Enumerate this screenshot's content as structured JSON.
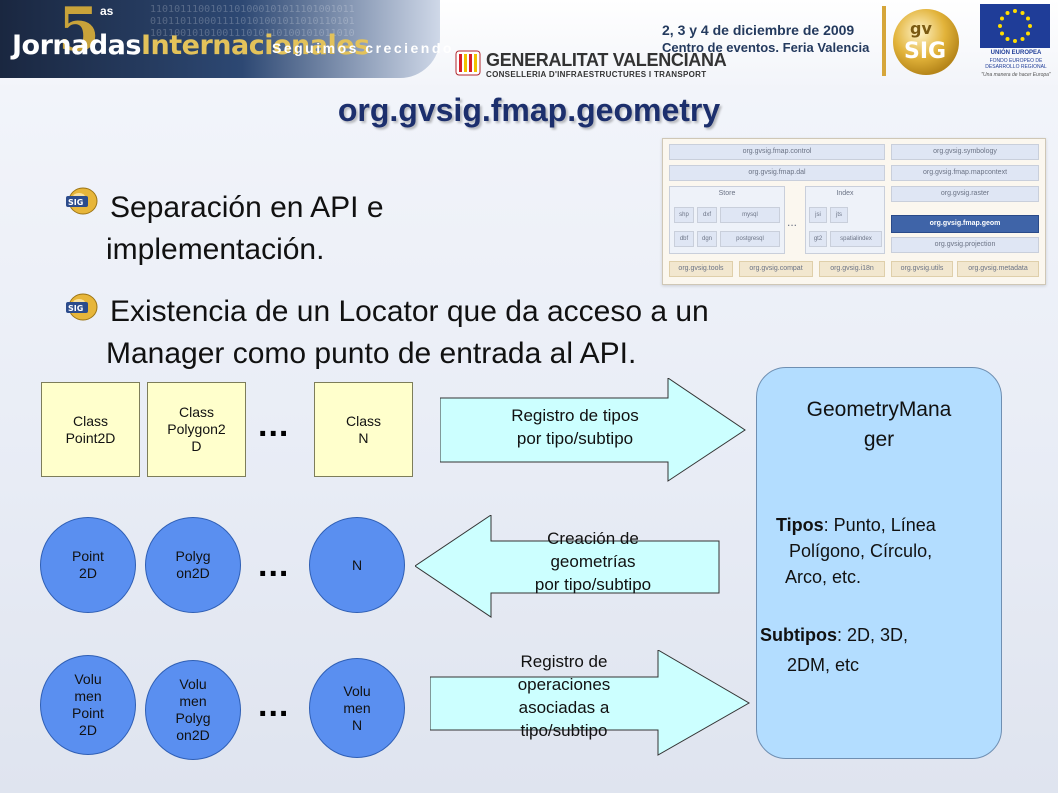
{
  "header": {
    "logo_number": "5",
    "logo_superscript": "as",
    "logo_title_a": "Jornadas",
    "logo_title_b": "Internacionales",
    "logo_slogan": "Seguimos creciendo",
    "event_date": "2, 3 y 4 de diciembre de 2009",
    "event_place": "Centro de eventos. Feria Valencia",
    "sponsor_name": "GENERALITAT VALENCIANA",
    "sponsor_dept": "CONSELLERIA D'INFRAESTRUCTURES I TRANSPORT",
    "gvsig_logo_text": "gvSIG",
    "eu_name": "UNIÓN EUROPEA",
    "eu_fund": "FONDO EUROPEO DE DESARROLLO REGIONAL",
    "eu_motto": "\"Una manera de hacer Europa\""
  },
  "slide": {
    "title": "org.gvsig.fmap.geometry",
    "bullets": [
      {
        "line1": "Separación en API e",
        "line2": "implementación."
      },
      {
        "line1": "Existencia de un Locator que da acceso a un",
        "line2": "Manager como punto de entrada al API."
      }
    ]
  },
  "architecture": {
    "control": "org.gvsig.fmap.control",
    "symbology": "org.gvsig.symbology",
    "dal": "org.gvsig.fmap.dal",
    "mapcontext": "org.gvsig.fmap.mapcontext",
    "store": "Store",
    "index": "Index",
    "raster": "org.gvsig.raster",
    "geom": "org.gvsig.fmap.geom",
    "projection": "org.gvsig.projection",
    "shp": "shp",
    "dxf": "dxf",
    "mysql": "mysql",
    "dbf": "dbf",
    "dgn": "dgn",
    "postgresql": "postgresql",
    "jsi": "jsi",
    "jts": "jts",
    "gt2": "gt2",
    "spatialindex": "spatialindex",
    "ellipsis": "...",
    "tools": "org.gvsig.tools",
    "compat": "org.gvsig.compat",
    "i18n": "org.gvsig.i18n",
    "utils": "org.gvsig.utils",
    "metadata": "org.gvsig.metadata"
  },
  "diagram": {
    "class_row": [
      {
        "line1": "Class",
        "line2": "Point2D"
      },
      {
        "line1": "Class",
        "line2": "Polygon2",
        "line3": "D"
      },
      {
        "line1": "Class",
        "line2": "N"
      }
    ],
    "geom_row": [
      {
        "line1": "Point",
        "line2": "2D"
      },
      {
        "line1": "Polyg",
        "line2": "on2D"
      },
      {
        "line1": "N"
      }
    ],
    "volume_row": [
      {
        "line1": "Volu",
        "line2": "men",
        "line3": "Point",
        "line4": "2D"
      },
      {
        "line1": "Volu",
        "line2": "men",
        "line3": "Polyg",
        "line4": "on2D"
      },
      {
        "line1": "Volu",
        "line2": "men",
        "line3": "N"
      }
    ],
    "ellipsis": "...",
    "arrow_register_types": {
      "line1": "Registro de tipos",
      "line2": "por tipo/subtipo"
    },
    "arrow_create": {
      "line1": "Creación de",
      "line2": "geometrías",
      "line3": "por tipo/subtipo"
    },
    "arrow_register_ops": {
      "line1": "Registro de",
      "line2": "operaciones",
      "line3": "asociadas a",
      "line4": "tipo/subtipo"
    },
    "manager": {
      "name_line1": "GeometryMana",
      "name_line2": "ger",
      "types_label": "Tipos",
      "types_rest": ": Punto, Línea",
      "types_line2": "Polígono, Círculo,",
      "types_line3": "Arco, etc.",
      "subtypes_label": "Subtipos",
      "subtypes_rest": ": 2D, 3D,",
      "subtypes_line2": "2DM, etc"
    }
  },
  "colors": {
    "title": "#1c2f6d",
    "class_box": "#ffffcc",
    "circle": "#5a8ff0",
    "arrow": "#ccffff",
    "manager": "#b3ddff"
  }
}
